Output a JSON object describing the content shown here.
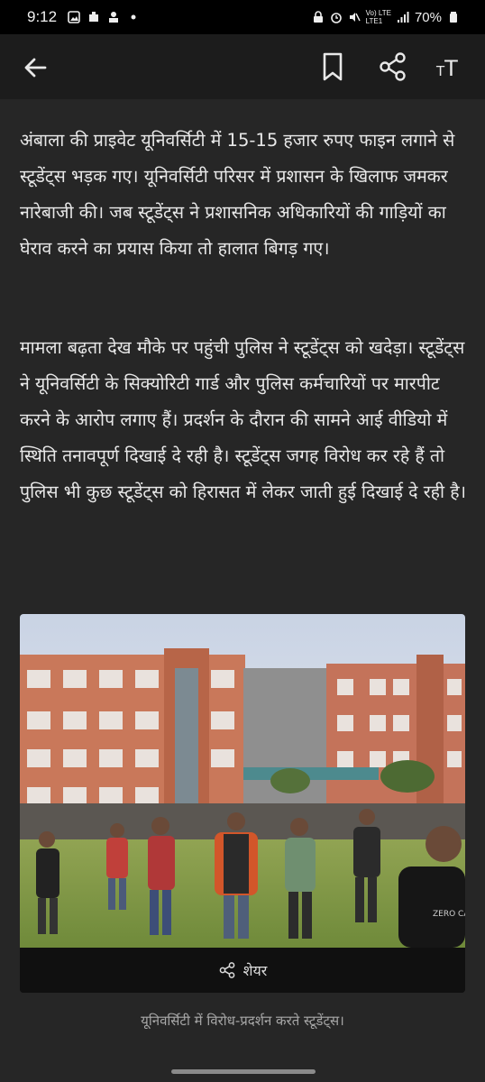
{
  "status_bar": {
    "time": "9:12",
    "network": "Vo) LTE\nLTE1",
    "network_top": "Vo) LTE",
    "network_bottom": "LTE1",
    "battery": "70%"
  },
  "app_bar": {
    "textsize_label": "TT"
  },
  "article": {
    "paragraphs": [
      "अंबाला की प्राइवेट यूनिवर्सिटी में 15-15 हजार रुपए फाइन लगाने से स्टूडेंट्स भड़क गए। यूनिवर्सिटी परिसर में प्रशासन के खिलाफ जमकर नारेबाजी की। जब स्टूडेंट्स ने प्रशासनिक अधिकारियों की गाड़ियों का घेराव करने का प्रयास किया तो हालात बिगड़ गए।",
      "मामला बढ़ता देख मौके पर पहुंची पुलिस ने स्टूडेंट्स को खदेड़ा। स्टूडेंट्स ने यूनिवर्सिटी के सिक्योरिटी गार्ड और पुलिस कर्मचारियों पर मारपीट करने के आरोप लगाए हैं। प्रदर्शन के दौरान की सामने आई वीडियो में स्थिति तनावपूर्ण दिखाई दे रही है। स्टूडेंट्स जगह विरोध कर रहे हैं तो पुलिस भी कुछ स्टूडेंट्स को हिरासत में लेकर जाती हुई दिखाई दे रही है।"
    ],
    "photo_shirt_text": "ZERO CARE",
    "share_label": "शेयर",
    "caption": "यूनिवर्सिटी में विरोध-प्रदर्शन करते स्टूडेंट्स।"
  },
  "colors": {
    "background": "#262626",
    "app_bar": "#1c1c1c",
    "text": "#e8e8e8",
    "caption": "#a8a8a8"
  },
  "icons": [
    "back-arrow-icon",
    "bookmark-icon",
    "share-icon",
    "text-size-icon"
  ]
}
